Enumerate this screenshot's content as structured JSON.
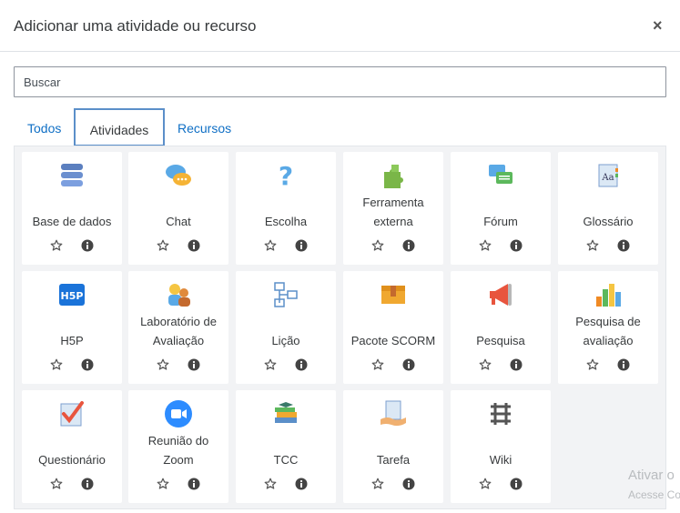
{
  "dialog": {
    "title": "Adicionar uma atividade ou recurso",
    "close_label": "×"
  },
  "search": {
    "placeholder": "Buscar"
  },
  "tabs": [
    {
      "label": "Todos"
    },
    {
      "label": "Atividades",
      "active": true
    },
    {
      "label": "Recursos"
    }
  ],
  "items": [
    {
      "line1": "",
      "line2": "Base de dados",
      "icon": "database-icon"
    },
    {
      "line1": "",
      "line2": "Chat",
      "icon": "chat-icon"
    },
    {
      "line1": "",
      "line2": "Escolha",
      "icon": "question-icon"
    },
    {
      "line1": "Ferramenta",
      "line2": "externa",
      "icon": "puzzle-icon"
    },
    {
      "line1": "",
      "line2": "Fórum",
      "icon": "forum-icon"
    },
    {
      "line1": "",
      "line2": "Glossário",
      "icon": "glossary-icon"
    },
    {
      "line1": "",
      "line2": "H5P",
      "icon": "h5p-icon"
    },
    {
      "line1": "Laboratório de",
      "line2": "Avaliação",
      "icon": "workshop-icon"
    },
    {
      "line1": "",
      "line2": "Lição",
      "icon": "lesson-icon"
    },
    {
      "line1": "",
      "line2": "Pacote SCORM",
      "icon": "scorm-icon"
    },
    {
      "line1": "",
      "line2": "Pesquisa",
      "icon": "megaphone-icon"
    },
    {
      "line1": "Pesquisa de",
      "line2": "avaliação",
      "icon": "bar-chart-icon"
    },
    {
      "line1": "",
      "line2": "Questionário",
      "icon": "quiz-icon"
    },
    {
      "line1": "Reunião do",
      "line2": "Zoom",
      "icon": "zoom-icon"
    },
    {
      "line1": "",
      "line2": "TCC",
      "icon": "books-icon"
    },
    {
      "line1": "",
      "line2": "Tarefa",
      "icon": "assignment-icon"
    },
    {
      "line1": "",
      "line2": "Wiki",
      "icon": "wiki-icon"
    }
  ],
  "watermark": {
    "line1": "Ativar o",
    "line2": "Acesse Co"
  }
}
